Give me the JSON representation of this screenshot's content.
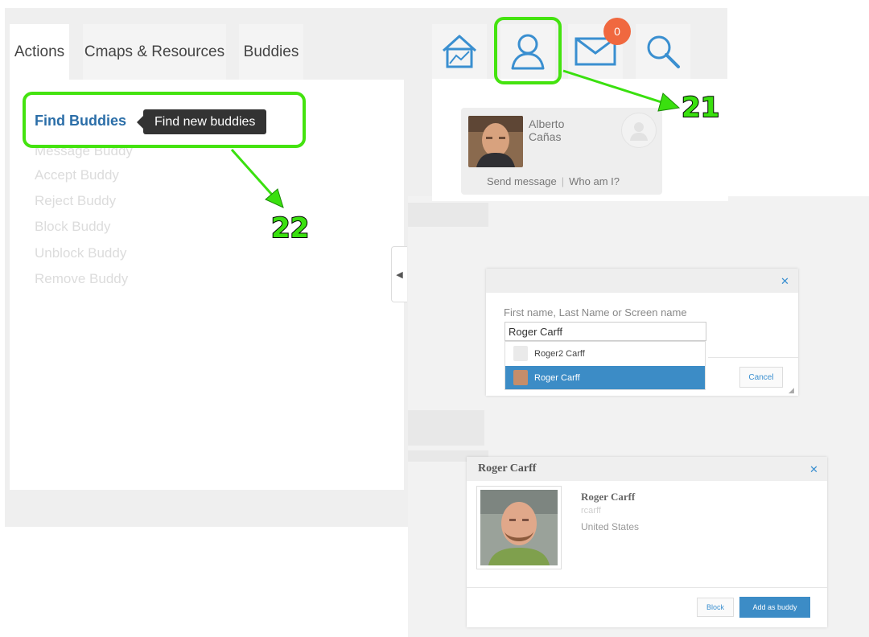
{
  "tabs": [
    {
      "label": "Actions"
    },
    {
      "label": "Cmaps & Resources"
    },
    {
      "label": "Buddies"
    }
  ],
  "actions": {
    "find": "Find Buddies",
    "tooltip": "Find new buddies",
    "items": [
      "Message Buddy",
      "Accept Buddy",
      "Reject Buddy",
      "Block Buddy",
      "Unblock Buddy",
      "Remove Buddy"
    ]
  },
  "top_icons": {
    "mail_badge": "0",
    "icons": [
      "home-icon",
      "user-icon",
      "mail-icon",
      "search-icon"
    ]
  },
  "profile": {
    "first_name": "Alberto",
    "last_name": "Cañas",
    "send_message": "Send message",
    "who_am_i": "Who am I?"
  },
  "search_dialog": {
    "label": "First name, Last Name or Screen name",
    "value": "Roger Carff",
    "suggestions": [
      "Roger2 Carff",
      "Roger Carff"
    ],
    "cancel": "Cancel"
  },
  "profile_dialog": {
    "title": "Roger Carff",
    "name": "Roger Carff",
    "handle": "rcarff",
    "country": "United States",
    "block": "Block",
    "add": "Add as buddy"
  },
  "callouts": {
    "first": "21",
    "second": "22"
  },
  "colors": {
    "highlight": "#44e30f",
    "accent": "#3c8cc6",
    "badge": "#f0683f",
    "link": "#2b6ea8"
  }
}
